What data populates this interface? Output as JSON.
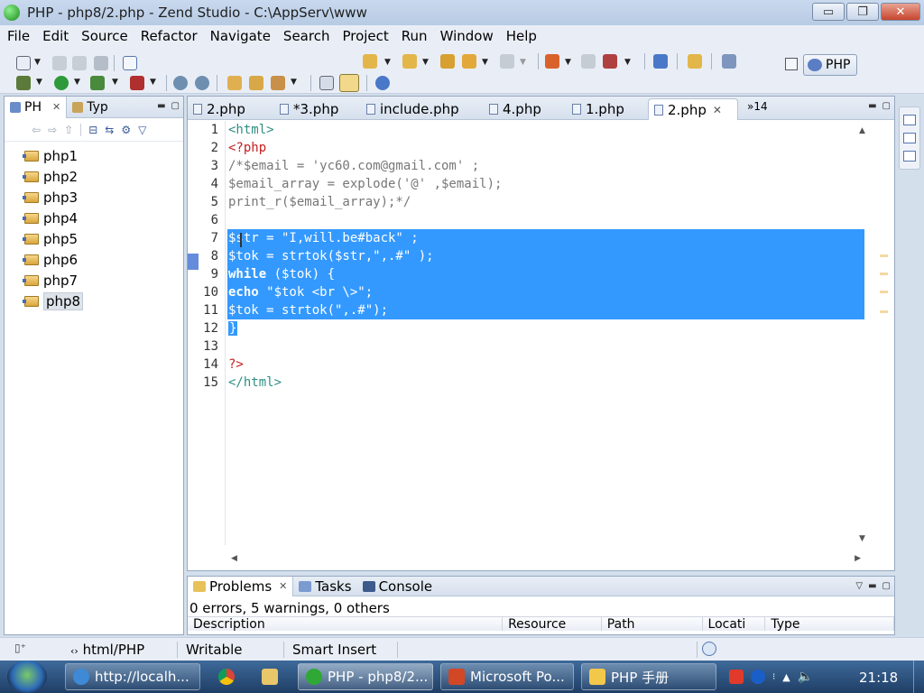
{
  "window": {
    "title": "PHP - php8/2.php - Zend Studio - C:\\AppServ\\www",
    "minimize": "▭",
    "restore": "❐",
    "close": "✕"
  },
  "menu": [
    "File",
    "Edit",
    "Source",
    "Refactor",
    "Navigate",
    "Search",
    "Project",
    "Run",
    "Window",
    "Help"
  ],
  "perspective": {
    "label": "PHP"
  },
  "left_panel": {
    "tabs": [
      {
        "label": "PH",
        "close": "✕"
      },
      {
        "label": "Typ"
      }
    ],
    "tree": [
      "php1",
      "php2",
      "php3",
      "php4",
      "php5",
      "php6",
      "php7",
      "php8"
    ],
    "selected": "php8"
  },
  "editor": {
    "tabs": [
      {
        "label": "2.php"
      },
      {
        "label": "*3.php"
      },
      {
        "label": "include.php"
      },
      {
        "label": "4.php"
      },
      {
        "label": "1.php"
      },
      {
        "label": "2.php",
        "active": true,
        "close": "✕"
      }
    ],
    "overflow": "»14",
    "line_numbers": [
      "1",
      "2",
      "3",
      "4",
      "5",
      "6",
      "7",
      "8",
      "9",
      "10",
      "11",
      "12",
      "13",
      "14",
      "15"
    ],
    "lines": [
      {
        "text": "<html>",
        "style": "tag"
      },
      {
        "text": "<?php",
        "style": "php"
      },
      {
        "text": "/*$email = 'yc60.com@gmail.com' ;",
        "style": "comment"
      },
      {
        "text": "$email_array = explode('@' ,$email);",
        "style": "comment"
      },
      {
        "text": "print_r($email_array);*/",
        "style": "comment"
      },
      {
        "text": "",
        "style": ""
      },
      {
        "text": "$str = \"I,will.be#back\" ;",
        "style": "var",
        "selected": true
      },
      {
        "text": "$tok = strtok($str,\",.#\" );",
        "style": "var",
        "selected": true
      },
      {
        "kw": "while",
        "text": " ($tok) {",
        "style": "var",
        "selected": true
      },
      {
        "kw": "echo",
        "text": " \"$tok <br \\>\";",
        "style": "var",
        "selected": true
      },
      {
        "text": "$tok = strtok(\",.#\");",
        "style": "var",
        "selected": true
      },
      {
        "text": "}",
        "style": "var",
        "selected_partial": true
      },
      {
        "text": "",
        "style": ""
      },
      {
        "text": "?>",
        "style": "php"
      },
      {
        "text": "</html>",
        "style": "tag"
      }
    ]
  },
  "bottom_panel": {
    "tabs": [
      {
        "label": "Problems",
        "close": "✕",
        "active": true
      },
      {
        "label": "Tasks"
      },
      {
        "label": "Console"
      }
    ],
    "summary": "0 errors, 5 warnings, 0 others",
    "columns": [
      "Description",
      "Resource",
      "Path",
      "Locati",
      "Type"
    ]
  },
  "status_bar": {
    "content_type": "html/PHP",
    "mode": "Writable",
    "insert_mode": "Smart Insert"
  },
  "taskbar": {
    "buttons": [
      {
        "label": "http://localh...",
        "icon": "ie-icon"
      },
      {
        "label": "PHP - php8/2...",
        "icon": "zend-icon",
        "active": true
      },
      {
        "label": "Microsoft Po...",
        "icon": "powerpoint-icon"
      },
      {
        "label": "PHP 手册",
        "icon": "help-icon"
      }
    ],
    "clock": "21:18"
  }
}
